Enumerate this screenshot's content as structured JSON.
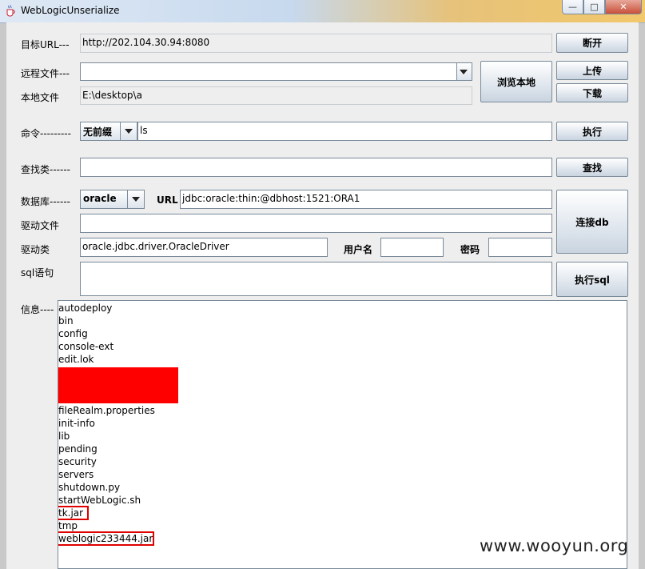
{
  "window": {
    "title": "WebLogicUnserialize",
    "min_glyph": "—",
    "max_glyph": "□",
    "close_glyph": "✕"
  },
  "target": {
    "label": "目标URL---",
    "value": "http://202.104.30.94:8080",
    "disconnect_label": "断开"
  },
  "remote_file": {
    "label": "远程文件---",
    "value": "",
    "upload_label": "上传",
    "download_label": "下载"
  },
  "browse_label": "浏览本地",
  "local_file": {
    "label": "本地文件",
    "value": "E:\\desktop\\a"
  },
  "command": {
    "label": "命令---------",
    "prefix_selected": "无前缀",
    "value": "ls",
    "exec_label": "执行"
  },
  "find_class": {
    "label": "查找类------",
    "value": "",
    "button_label": "查找"
  },
  "database": {
    "label": "数据库------",
    "selected": "oracle",
    "url_label": "URL",
    "url_value": "jdbc:oracle:thin:@dbhost:1521:ORA1",
    "connect_label": "连接db"
  },
  "driver_file": {
    "label": "驱动文件",
    "value": ""
  },
  "driver_class": {
    "label": "驱动类",
    "value": "oracle.jdbc.driver.OracleDriver",
    "username_label": "用户名",
    "username_value": "",
    "password_label": "密码",
    "password_value": ""
  },
  "sql": {
    "label": "sql语句",
    "value": "",
    "exec_label": "执行sql"
  },
  "info": {
    "label": "信息----",
    "lines": [
      "autodeploy",
      "bin",
      "config",
      "console-ext",
      "edit.lok",
      "",
      "",
      "fileRealm.properties",
      "init-info",
      "lib",
      "pending",
      "security",
      "servers",
      "shutdown.py",
      "startWebLogic.sh",
      "tk.jar",
      "tmp",
      "weblogic233444.jar"
    ]
  },
  "colors": {
    "redaction": "#ff0000",
    "highlight_box": "#e00000"
  },
  "watermark": "www.wooyun.org"
}
